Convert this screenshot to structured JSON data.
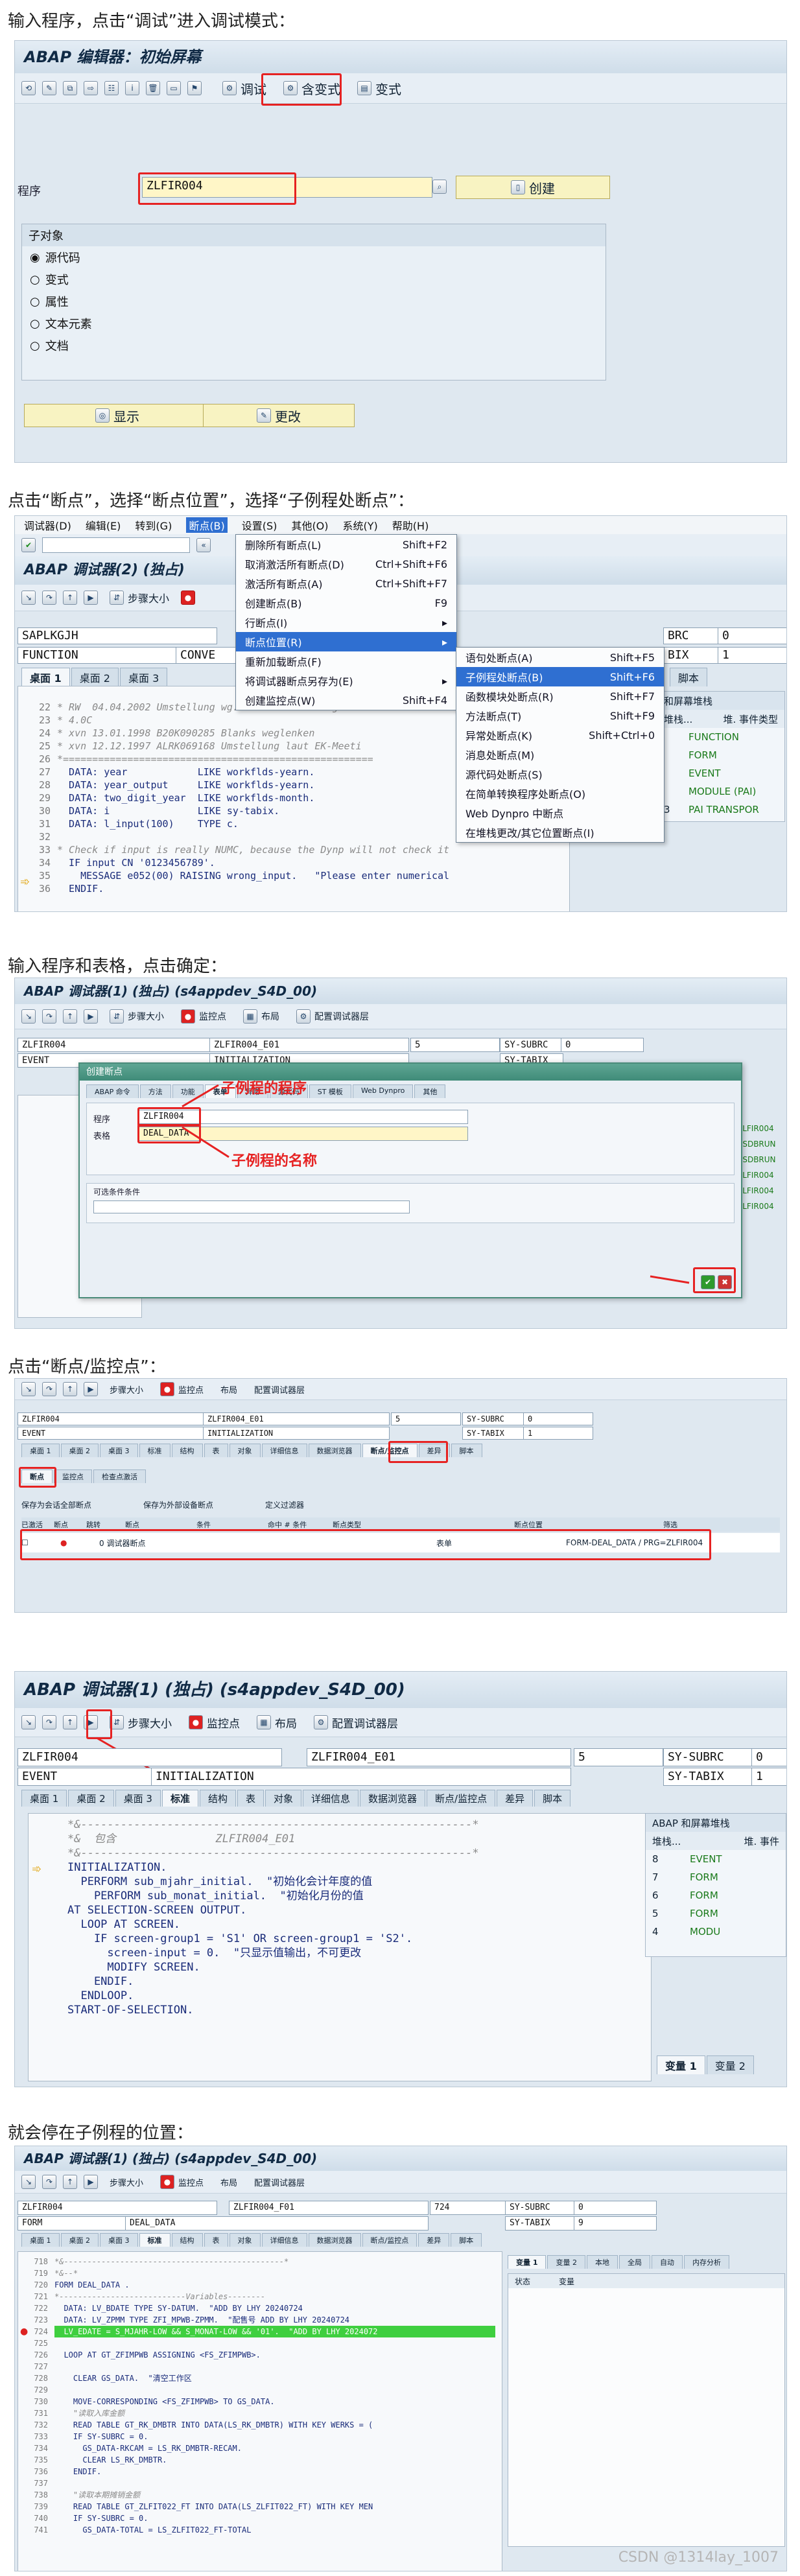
{
  "captions": [
    "输入程序，点击“调试”进入调试模式：",
    "点击“断点”，选择“断点位置”，选择“子例程处断点”：",
    "输入程序和表格，点击确定：",
    "点击“断点/监控点”：",
    "就会停在子例程的位置："
  ],
  "s1": {
    "title": "ABAP 编辑器：初始屏幕",
    "debug_label": "调试",
    "variant_label": "含变式",
    "variant2_label": "变式",
    "program_label": "程序",
    "program_value": "ZLFIR004",
    "create_label": "创建",
    "subobj_title": "子对象",
    "options": [
      "源代码",
      "变式",
      "属性",
      "文本元素",
      "文档"
    ],
    "display_label": "显示",
    "change_label": "更改"
  },
  "s2": {
    "menubar": [
      "调试器(D)",
      "编辑(E)",
      "转到(G)",
      "断点(B)",
      "设置(S)",
      "其他(O)",
      "系统(Y)",
      "帮助(H)"
    ],
    "title": "ABAP 调试器(2) (独占)",
    "step_label": "步骤大小",
    "field1": "SAPLKGJH",
    "field2": "FUNCTION",
    "field3": "CONVE",
    "tabs": [
      "桌面 1",
      "桌面 2",
      "桌面 3"
    ],
    "menu_items": [
      {
        "label": "删除所有断点(L)",
        "key": "Shift+F2"
      },
      {
        "label": "取消激活所有断点(D)",
        "key": "Ctrl+Shift+F6"
      },
      {
        "label": "激活所有断点(A)",
        "key": "Ctrl+Shift+F7"
      },
      {
        "label": "创建断点(B)",
        "key": "F9"
      },
      {
        "label": "行断点(I)",
        "key": "▸"
      },
      {
        "label": "断点位置(R)",
        "key": "▸"
      },
      {
        "label": "重新加载断点(F)",
        "key": ""
      },
      {
        "label": "将调试器断点另存为(E)",
        "key": "▸"
      },
      {
        "label": "创建监控点(W)",
        "key": "Shift+F4"
      }
    ],
    "submenu_items": [
      {
        "label": "语句处断点(A)",
        "key": "Shift+F5"
      },
      {
        "label": "子例程处断点(B)",
        "key": "Shift+F6"
      },
      {
        "label": "函数模块处断点(R)",
        "key": "Shift+F7"
      },
      {
        "label": "方法断点(T)",
        "key": "Shift+F9"
      },
      {
        "label": "异常处断点(K)",
        "key": "Shift+Ctrl+0"
      },
      {
        "label": "消息处断点(M)",
        "key": ""
      },
      {
        "label": "源代码处断点(S)",
        "key": ""
      },
      {
        "label": "在简单转换程序处断点(O)",
        "key": ""
      },
      {
        "label": "Web Dynpro 中断点",
        "key": ""
      },
      {
        "label": "在堆栈更改/其它位置断点(I)",
        "key": ""
      }
    ],
    "right_fields": [
      "BRC",
      "0",
      "BIX",
      "1"
    ],
    "right_tab": "脚本",
    "stack_title": "和屏幕堆栈",
    "stack_header": [
      "堆栈...",
      "堆. 事件类型"
    ],
    "stack_rows": [
      {
        "n": "",
        "t": "FUNCTION"
      },
      {
        "n": "",
        "t": "FORM"
      },
      {
        "n": "",
        "t": "EVENT"
      },
      {
        "n": "",
        "t": "MODULE (PAI)"
      },
      {
        "n": "3",
        "t": "PAI TRANSPOR"
      }
    ],
    "code_lines": [
      {
        "ln": "22",
        "t": "* RW  04.04.2002 Umstellung wg. Gleichbehandlung NUM",
        "c": true
      },
      {
        "ln": "23",
        "t": "* 4.0C",
        "c": true
      },
      {
        "ln": "24",
        "t": "* xvn 13.01.1998 B20K090285 Blanks weglenken",
        "c": true
      },
      {
        "ln": "25",
        "t": "* xvn 12.12.1997 ALRK069168 Umstellung laut EK-Meeti",
        "c": true
      },
      {
        "ln": "26",
        "t": "*=====================================================",
        "c": true
      },
      {
        "ln": "27",
        "t": "  DATA: year            LIKE workflds-yearn.",
        "c": false
      },
      {
        "ln": "28",
        "t": "  DATA: year_output     LIKE workflds-yearn.",
        "c": false
      },
      {
        "ln": "29",
        "t": "  DATA: two_digit_year  LIKE workflds-month.",
        "c": false
      },
      {
        "ln": "30",
        "t": "  DATA: i               LIKE sy-tabix.",
        "c": false
      },
      {
        "ln": "31",
        "t": "  DATA: l_input(100)    TYPE c.",
        "c": false
      },
      {
        "ln": "32",
        "t": "",
        "c": false
      },
      {
        "ln": "33",
        "t": "* Check if input is really NUMC, because the Dynp will not check it",
        "c": true
      },
      {
        "ln": "34",
        "t": "  IF input CN '0123456789'.",
        "c": false
      },
      {
        "ln": "35",
        "t": "    MESSAGE e052(00) RAISING wrong_input.   \"Please enter numerical",
        "c": false
      },
      {
        "ln": "36",
        "t": "  ENDIF.",
        "c": false
      }
    ]
  },
  "s3": {
    "title": "ABAP 调试器(1) (独占) (s4appdev_S4D_00)",
    "step_label": "步骤大小",
    "watch_label": "监控点",
    "layout_label": "布局",
    "config_label": "配置调试器层",
    "f1": "ZLFIR004",
    "f2": "ZLFIR004_E01",
    "f3": "5",
    "f4": "SY-SUBRC",
    "f5": "0",
    "f6": "EVENT",
    "f7": "INITIALIZATION",
    "f8": "SY-TABIX",
    "dlg_title": "创建断点",
    "dlg_tabs": [
      "ABAP 命令",
      "方法",
      "功能",
      "表单",
      "异常",
      "源代码",
      "ST 模板",
      "Web Dynpro",
      "其他"
    ],
    "prog_label": "程序",
    "prog_value": "ZLFIR004",
    "form_label": "表格",
    "form_value": "DEAL_DATA",
    "cond_label": "可选条件条件",
    "anno1": "子例程的程序",
    "anno2": "子例程的名称",
    "right_list": [
      "ZLFIR004",
      "RSDBRUN",
      "RSDBRUN",
      "ZLFIR004",
      "ZLFIR004",
      "ZLFIR004"
    ]
  },
  "s4": {
    "step_label": "步骤大小",
    "watch_label": "监控点",
    "layout_label": "布局",
    "config_label": "配置调试器层",
    "f1": "ZLFIR004",
    "f2": "ZLFIR004_E01",
    "f3": "5",
    "f4": "SY-SUBRC",
    "f5": "0",
    "f6": "EVENT",
    "f7": "INITIALIZATION",
    "f8": "SY-TABIX",
    "f9": "1",
    "tabs": [
      "桌面 1",
      "桌面 2",
      "桌面 3",
      "标准",
      "结构",
      "表",
      "对象",
      "详细信息",
      "数据浏览器",
      "断点/监控点",
      "差异",
      "脚本"
    ],
    "subtabs": [
      "断点",
      "监控点",
      "检查点激活"
    ],
    "actions": [
      "保存为会话全部断点",
      "保存为外部设备断点",
      "定义过滤器"
    ],
    "cols": [
      "已激活",
      "断点",
      "跳转",
      "断点",
      "条件",
      "命中 # 条件",
      "断点类型",
      "断点位置",
      "筛选"
    ],
    "row_type": "0 调试器断点",
    "row_kind": "表单",
    "row_loc": "FORM-DEAL_DATA / PRG=ZLFIR004"
  },
  "s5": {
    "title": "ABAP 调试器(1) (独占) (s4appdev_S4D_00)",
    "step_label": "步骤大小",
    "watch_label": "监控点",
    "layout_label": "布局",
    "config_label": "配置调试器层",
    "f1": "ZLFIR004",
    "f2": "ZLFIR004_E01",
    "f3": "5",
    "f4": "SY-SUBRC",
    "f5": "0",
    "f6": "EVENT",
    "f7": "INITIALIZATION",
    "f8": "SY-TABIX",
    "f9": "1",
    "tabs": [
      "桌面 1",
      "桌面 2",
      "桌面 3",
      "标准",
      "结构",
      "表",
      "对象",
      "详细信息",
      "数据浏览器",
      "断点/监控点",
      "差异",
      "脚本"
    ],
    "stack_title": "ABAP 和屏幕堆栈",
    "stack_header": [
      "堆栈...",
      "堆. 事件"
    ],
    "stack_rows": [
      {
        "n": "8",
        "t": "EVENT"
      },
      {
        "n": "7",
        "t": "FORM"
      },
      {
        "n": "6",
        "t": "FORM"
      },
      {
        "n": "5",
        "t": "FORM"
      },
      {
        "n": "4",
        "t": "MODU"
      }
    ],
    "var_tabs": [
      "变量 1",
      "变量 2"
    ],
    "code_lines": [
      {
        "t": "*&-----------------------------------------------------------*",
        "c": true
      },
      {
        "t": "*&  包含               ZLFIR004_E01",
        "c": true
      },
      {
        "t": "*&-----------------------------------------------------------*",
        "c": true
      },
      {
        "t": "INITIALIZATION.",
        "c": false
      },
      {
        "t": "  PERFORM sub_mjahr_initial.  \"初始化会计年度的值",
        "c": false
      },
      {
        "t": "    PERFORM sub_monat_initial.  \"初始化月份的值",
        "c": false
      },
      {
        "t": "",
        "c": false
      },
      {
        "t": "AT SELECTION-SCREEN OUTPUT.",
        "c": false
      },
      {
        "t": "  LOOP AT SCREEN.",
        "c": false
      },
      {
        "t": "    IF screen-group1 = 'S1' OR screen-group1 = 'S2'.",
        "c": false
      },
      {
        "t": "      screen-input = 0.  \"只显示值输出，不可更改",
        "c": false
      },
      {
        "t": "      MODIFY SCREEN.",
        "c": false
      },
      {
        "t": "    ENDIF.",
        "c": false
      },
      {
        "t": "  ENDLOOP.",
        "c": false
      },
      {
        "t": "",
        "c": false
      },
      {
        "t": "",
        "c": false
      },
      {
        "t": "START-OF-SELECTION.",
        "c": false
      }
    ]
  },
  "s6": {
    "title": "ABAP 调试器(1) (独占) (s4appdev_S4D_00)",
    "step_label": "步骤大小",
    "watch_label": "监控点",
    "layout_label": "布局",
    "config_label": "配置调试器层",
    "f1": "ZLFIR004",
    "f2": "ZLFIR004_F01",
    "f3": "724",
    "f4": "SY-SUBRC",
    "f5": "0",
    "f6": "FORM",
    "f7": "DEAL_DATA",
    "f8": "SY-TABIX",
    "f9": "9",
    "tabs": [
      "桌面 1",
      "桌面 2",
      "桌面 3",
      "标准",
      "结构",
      "表",
      "对象",
      "详细信息",
      "数据浏览器",
      "断点/监控点",
      "差异",
      "脚本"
    ],
    "var_tabs": [
      "变量 1",
      "变量 2",
      "本地",
      "全局",
      "自动",
      "内存分析"
    ],
    "var_cols": [
      "状态",
      "变量"
    ],
    "code_lines": [
      {
        "ln": "718",
        "t": "*&-----------------------------------------------*",
        "c": true
      },
      {
        "ln": "719",
        "t": "*&--*",
        "c": true
      },
      {
        "ln": "720",
        "t": "FORM DEAL_DATA .",
        "c": false
      },
      {
        "ln": "721",
        "t": "*---------------------------Variables--------",
        "c": true
      },
      {
        "ln": "722",
        "t": "  DATA: LV_BDATE TYPE SY-DATUM.  \"ADD BY LHY 20240724",
        "c": false
      },
      {
        "ln": "723",
        "t": "  DATA: LV_ZPMM TYPE ZFI_MPWB-ZPMM.  \"配售号 ADD BY LHY 20240724",
        "c": false
      },
      {
        "ln": "724",
        "t": "  LV_EDATE = S_MJAHR-LOW && S_MONAT-LOW && '01'.  \"ADD BY LHY 2024072",
        "c": false,
        "hl": true
      },
      {
        "ln": "725",
        "t": "",
        "c": false
      },
      {
        "ln": "726",
        "t": "  LOOP AT GT_ZFIMPWB ASSIGNING <FS_ZFIMPWB>.",
        "c": false
      },
      {
        "ln": "727",
        "t": "",
        "c": false
      },
      {
        "ln": "728",
        "t": "    CLEAR GS_DATA.  \"清空工作区",
        "c": false
      },
      {
        "ln": "729",
        "t": "",
        "c": false
      },
      {
        "ln": "730",
        "t": "    MOVE-CORRESPONDING <FS_ZFIMPWB> TO GS_DATA.",
        "c": false
      },
      {
        "ln": "731",
        "t": "    \"读取入库金额",
        "c": true
      },
      {
        "ln": "732",
        "t": "    READ TABLE GT_RK_DMBTR INTO DATA(LS_RK_DMBTR) WITH KEY WERKS = (",
        "c": false
      },
      {
        "ln": "733",
        "t": "    IF SY-SUBRC = 0.",
        "c": false
      },
      {
        "ln": "734",
        "t": "      GS_DATA-RKCAM = LS_RK_DMBTR-RECAM.",
        "c": false
      },
      {
        "ln": "735",
        "t": "      CLEAR LS_RK_DMBTR.",
        "c": false
      },
      {
        "ln": "736",
        "t": "    ENDIF.",
        "c": false
      },
      {
        "ln": "737",
        "t": "",
        "c": false
      },
      {
        "ln": "738",
        "t": "    \"读取本期摊销金额",
        "c": true
      },
      {
        "ln": "739",
        "t": "    READ TABLE GT_ZLFIT022_FT INTO DATA(LS_ZLFIT022_FT) WITH KEY MEN",
        "c": false
      },
      {
        "ln": "740",
        "t": "    IF SY-SUBRC = 0.",
        "c": false
      },
      {
        "ln": "741",
        "t": "      GS_DATA-TOTAL = LS_ZLFIT022_FT-TOTAL",
        "c": false
      }
    ],
    "watermark": "CSDN @1314lay_1007"
  }
}
